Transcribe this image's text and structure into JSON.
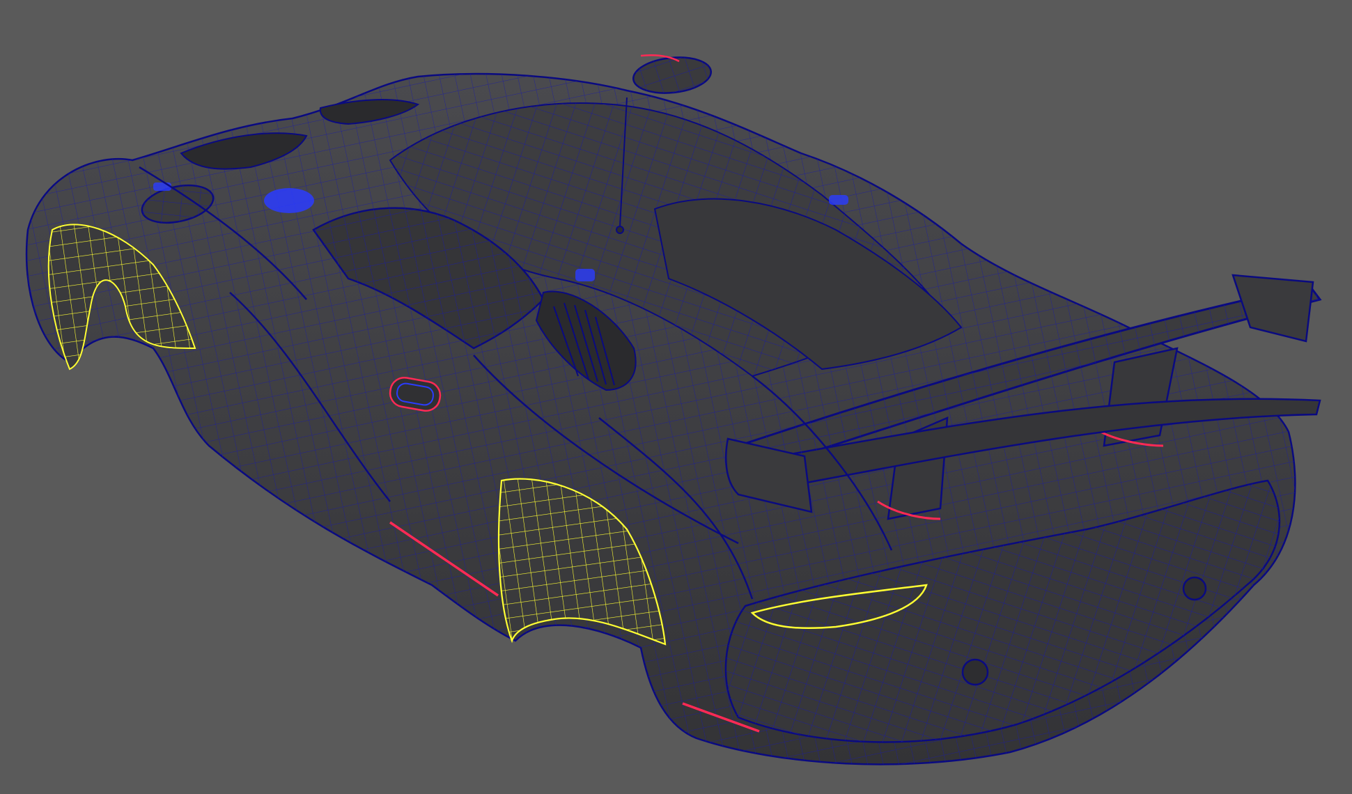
{
  "viewport": {
    "background_color": "#5a5a5a",
    "shaded_color": "#3f3f42",
    "wire_color": "#1a1aa8",
    "edge_color": "#0a0a80",
    "selected_color": "#ffff33",
    "highlight_color": "#ff2a55",
    "accent_color": "#2b3cff"
  }
}
